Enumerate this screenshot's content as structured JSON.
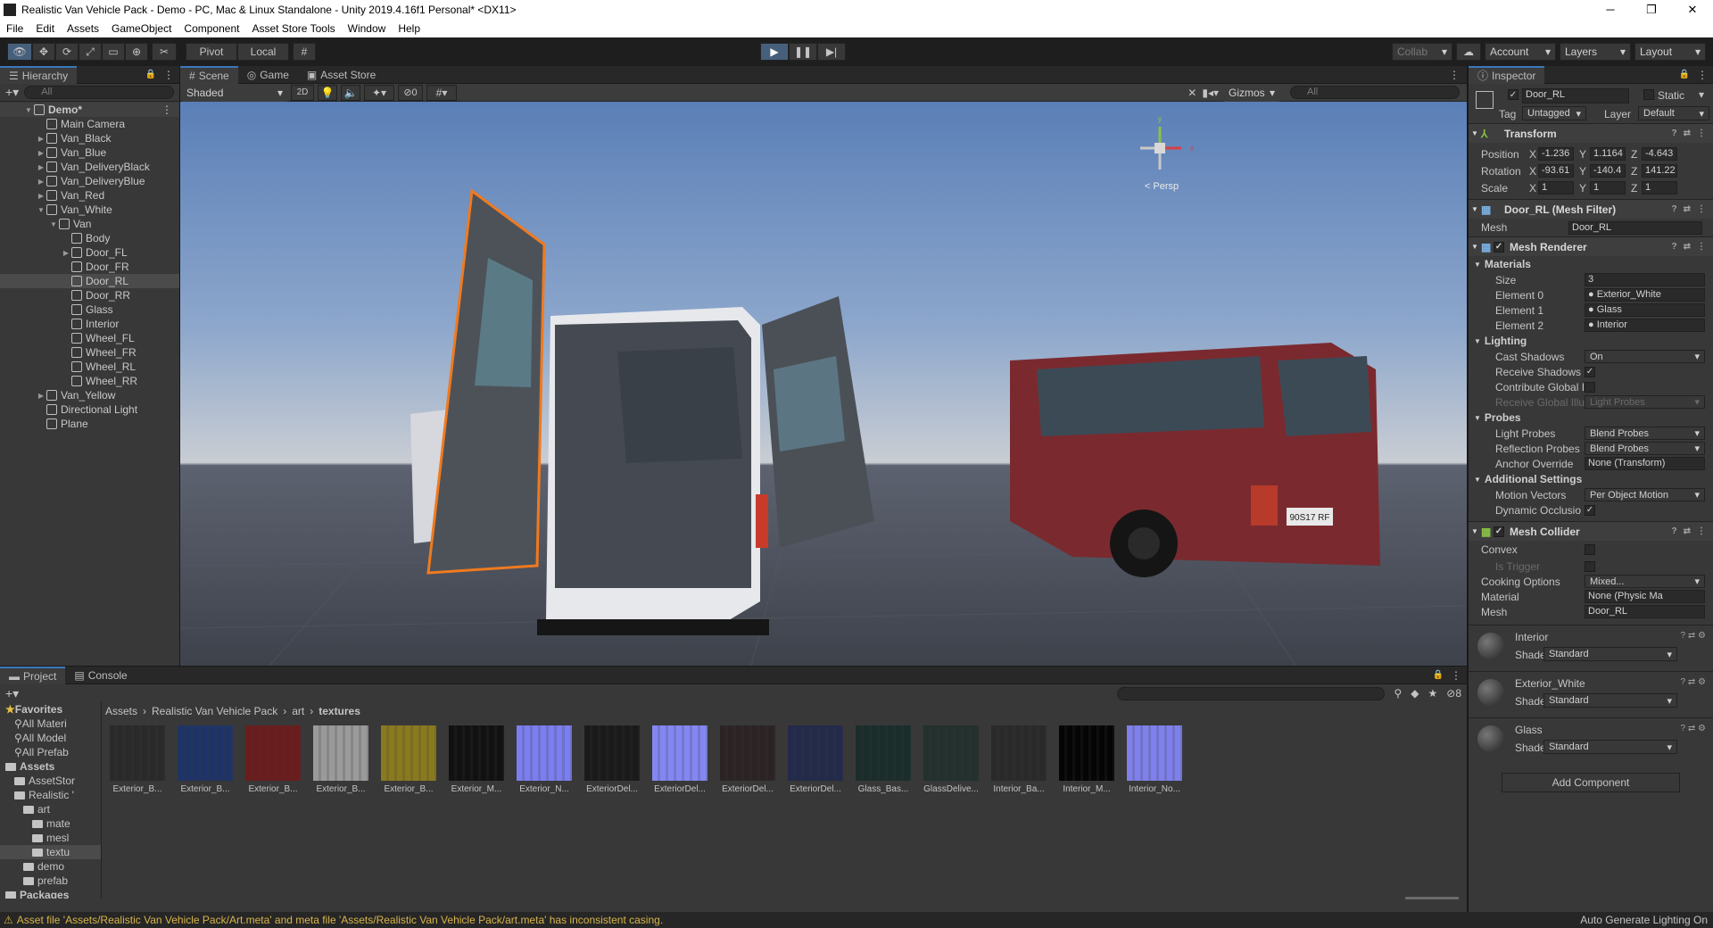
{
  "window": {
    "title": "Realistic Van Vehicle Pack - Demo - PC, Mac & Linux Standalone - Unity 2019.4.16f1 Personal* <DX11>"
  },
  "menu": [
    "File",
    "Edit",
    "Assets",
    "GameObject",
    "Component",
    "Asset Store Tools",
    "Window",
    "Help"
  ],
  "toolbar": {
    "pivot": "Pivot",
    "local": "Local",
    "collab": "Collab",
    "account": "Account",
    "layers": "Layers",
    "layout": "Layout"
  },
  "hierarchy": {
    "tab": "Hierarchy",
    "search_placeholder": "All",
    "items": [
      {
        "label": "Demo*",
        "depth": 0,
        "arrow": "open",
        "scene": true
      },
      {
        "label": "Main Camera",
        "depth": 1,
        "arrow": ""
      },
      {
        "label": "Van_Black",
        "depth": 1,
        "arrow": "closed"
      },
      {
        "label": "Van_Blue",
        "depth": 1,
        "arrow": "closed"
      },
      {
        "label": "Van_DeliveryBlack",
        "depth": 1,
        "arrow": "closed"
      },
      {
        "label": "Van_DeliveryBlue",
        "depth": 1,
        "arrow": "closed"
      },
      {
        "label": "Van_Red",
        "depth": 1,
        "arrow": "closed"
      },
      {
        "label": "Van_White",
        "depth": 1,
        "arrow": "open"
      },
      {
        "label": "Van",
        "depth": 2,
        "arrow": "open"
      },
      {
        "label": "Body",
        "depth": 3,
        "arrow": ""
      },
      {
        "label": "Door_FL",
        "depth": 3,
        "arrow": "closed"
      },
      {
        "label": "Door_FR",
        "depth": 3,
        "arrow": ""
      },
      {
        "label": "Door_RL",
        "depth": 3,
        "arrow": "",
        "selected": true
      },
      {
        "label": "Door_RR",
        "depth": 3,
        "arrow": ""
      },
      {
        "label": "Glass",
        "depth": 3,
        "arrow": ""
      },
      {
        "label": "Interior",
        "depth": 3,
        "arrow": ""
      },
      {
        "label": "Wheel_FL",
        "depth": 3,
        "arrow": ""
      },
      {
        "label": "Wheel_FR",
        "depth": 3,
        "arrow": ""
      },
      {
        "label": "Wheel_RL",
        "depth": 3,
        "arrow": ""
      },
      {
        "label": "Wheel_RR",
        "depth": 3,
        "arrow": ""
      },
      {
        "label": "Van_Yellow",
        "depth": 1,
        "arrow": "closed"
      },
      {
        "label": "Directional Light",
        "depth": 1,
        "arrow": ""
      },
      {
        "label": "Plane",
        "depth": 1,
        "arrow": ""
      }
    ]
  },
  "scene": {
    "tabs": [
      "Scene",
      "Game",
      "Asset Store"
    ],
    "shading": "Shaded",
    "mode2d": "2D",
    "hidden_count": "0",
    "gizmos": "Gizmos",
    "search_placeholder": "All",
    "persp": "< Persp",
    "plate": "90S17 RF",
    "gizmo_axis_y": "y",
    "gizmo_axis_x": "x"
  },
  "inspector": {
    "tab": "Inspector",
    "object_name": "Door_RL",
    "static": "Static",
    "tag_label": "Tag",
    "tag": "Untagged",
    "layer_label": "Layer",
    "layer": "Default",
    "transform": {
      "title": "Transform",
      "position": {
        "label": "Position",
        "x": "-1.236",
        "y": "1.1164",
        "z": "-4.643"
      },
      "rotation": {
        "label": "Rotation",
        "x": "-93.61",
        "y": "-140.4",
        "z": "141.22"
      },
      "scale": {
        "label": "Scale",
        "x": "1",
        "y": "1",
        "z": "1"
      }
    },
    "mesh_filter": {
      "title": "Door_RL (Mesh Filter)",
      "mesh_label": "Mesh",
      "mesh": "Door_RL"
    },
    "mesh_renderer": {
      "title": "Mesh Renderer",
      "materials": "Materials",
      "size_label": "Size",
      "size": "3",
      "elements": [
        {
          "label": "Element 0",
          "value": "Exterior_White"
        },
        {
          "label": "Element 1",
          "value": "Glass"
        },
        {
          "label": "Element 2",
          "value": "Interior"
        }
      ],
      "lighting": "Lighting",
      "cast_shadows_label": "Cast Shadows",
      "cast_shadows": "On",
      "receive_shadows_label": "Receive Shadows",
      "contribute_gi_label": "Contribute Global I",
      "receive_gi_label": "Receive Global Illu",
      "receive_gi": "Light Probes",
      "probes": "Probes",
      "light_probes_label": "Light Probes",
      "light_probes": "Blend Probes",
      "reflection_probes_label": "Reflection Probes",
      "reflection_probes": "Blend Probes",
      "anchor_label": "Anchor Override",
      "anchor": "None (Transform)",
      "additional": "Additional Settings",
      "motion_vectors_label": "Motion Vectors",
      "motion_vectors": "Per Object Motion",
      "dynamic_occlusion_label": "Dynamic Occlusio"
    },
    "mesh_collider": {
      "title": "Mesh Collider",
      "convex_label": "Convex",
      "trigger_label": "Is Trigger",
      "cooking_label": "Cooking Options",
      "cooking": "Mixed...",
      "material_label": "Material",
      "material": "None (Physic Ma",
      "mesh_label": "Mesh",
      "mesh": "Door_RL"
    },
    "materials": [
      {
        "name": "Interior",
        "shader_label": "Shader",
        "shader": "Standard"
      },
      {
        "name": "Exterior_White",
        "shader_label": "Shader",
        "shader": "Standard"
      },
      {
        "name": "Glass",
        "shader_label": "Shader",
        "shader": "Standard"
      }
    ],
    "add_component": "Add Component"
  },
  "project": {
    "tabs": [
      "Project",
      "Console"
    ],
    "breadcrumb": [
      "Assets",
      "Realistic Van Vehicle Pack",
      "art",
      "textures"
    ],
    "hidden_count": "8",
    "tree": [
      {
        "label": "Favorites",
        "depth": 0,
        "star": true
      },
      {
        "label": "All Materi",
        "depth": 1
      },
      {
        "label": "All Model",
        "depth": 1
      },
      {
        "label": "All Prefab",
        "depth": 1
      },
      {
        "label": "Assets",
        "depth": 0
      },
      {
        "label": "AssetStor",
        "depth": 1
      },
      {
        "label": "Realistic '",
        "depth": 1
      },
      {
        "label": "art",
        "depth": 2
      },
      {
        "label": "mate",
        "depth": 3
      },
      {
        "label": "mesl",
        "depth": 3
      },
      {
        "label": "textu",
        "depth": 3,
        "selected": true
      },
      {
        "label": "demo",
        "depth": 2
      },
      {
        "label": "prefab",
        "depth": 2
      },
      {
        "label": "Packages",
        "depth": 0
      }
    ],
    "assets": [
      {
        "label": "Exterior_B...",
        "color": "#2a2a2a"
      },
      {
        "label": "Exterior_B...",
        "color": "#1f3466"
      },
      {
        "label": "Exterior_B...",
        "color": "#6b1c1c"
      },
      {
        "label": "Exterior_B...",
        "color": "#9a9a9a"
      },
      {
        "label": "Exterior_B...",
        "color": "#8a7a1e"
      },
      {
        "label": "Exterior_M...",
        "color": "#111111"
      },
      {
        "label": "Exterior_N...",
        "color": "#7b7ef0"
      },
      {
        "label": "ExteriorDel...",
        "color": "#1a1a1a"
      },
      {
        "label": "ExteriorDel...",
        "color": "#8487f2"
      },
      {
        "label": "ExteriorDel...",
        "color": "#2c2424"
      },
      {
        "label": "ExteriorDel...",
        "color": "#232a4a"
      },
      {
        "label": "Glass_Bas...",
        "color": "#1a2d2a"
      },
      {
        "label": "GlassDelive...",
        "color": "#23302e"
      },
      {
        "label": "Interior_Ba...",
        "color": "#2a2a2a"
      },
      {
        "label": "Interior_M...",
        "color": "#050505"
      },
      {
        "label": "Interior_No...",
        "color": "#7f80ec"
      }
    ]
  },
  "status": {
    "message": "Asset file 'Assets/Realistic Van Vehicle Pack/Art.meta' and meta file 'Assets/Realistic Van Vehicle Pack/art.meta' has inconsistent casing.",
    "right": "Auto Generate Lighting On"
  },
  "colors": {
    "accent": "#3a79bb",
    "selection_outline": "#f07a1f",
    "play_active": "#46607c"
  }
}
